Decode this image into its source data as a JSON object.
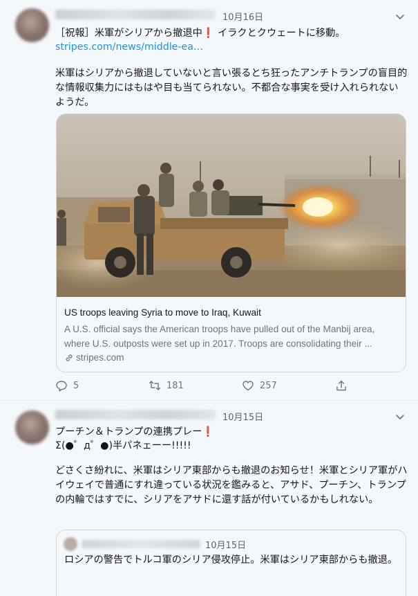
{
  "tweets": [
    {
      "date": "10月16日",
      "line1_prefix": "［祝報］米軍がシリアから撤退中",
      "line1_mark": "❗",
      "line1_suffix": " イラクとクウェートに移動。",
      "link": "stripes.com/news/middle-ea…",
      "body": "米軍はシリアから撤退していないと言い張るとち狂ったアンチトランプの盲目的な情報収集力にはもはや目も当てられない。不都合な事実を受け入れられないようだ。",
      "card": {
        "title": "US troops leaving Syria to move to Iraq, Kuwait",
        "desc_line1": "A U.S. official says the American troops have pulled out of the Manbij area,",
        "desc_line2": "where U.S. outposts were set up in 2017. Troops are consolidating their ...",
        "domain": "stripes.com"
      },
      "actions": {
        "replies": "5",
        "retweets": "181",
        "likes": "257"
      }
    },
    {
      "date": "10月15日",
      "line1_prefix": "プーチン＆トランプの連携プレー",
      "line1_mark": "❗",
      "line2": "Σ(●゜д゜●)半パネェーー!!!!!",
      "body": "どさくさ紛れに、米軍はシリア東部からも撤退のお知らせ！米軍とシリア軍がハイウェイで普通にすれ違っている状況を鑑みると、アサド、プーチン、トランプの内輪ではすでに、シリアをアサドに還す話が付いているかもしれない。",
      "quote": {
        "date": "10月15日",
        "text": "ロシアの警告でトルコ軍のシリア侵攻停止。米軍はシリア東部からも撤退。"
      }
    }
  ],
  "icons": {
    "reply": "reply-icon",
    "retweet": "retweet-icon",
    "like": "like-icon",
    "share": "share-icon",
    "more": "chevron-down-icon",
    "link": "link-icon"
  },
  "colors": {
    "link": "#1b95e0",
    "accent_mark": "#e0245e",
    "muted": "#657786",
    "background": "#f5f8fa"
  }
}
